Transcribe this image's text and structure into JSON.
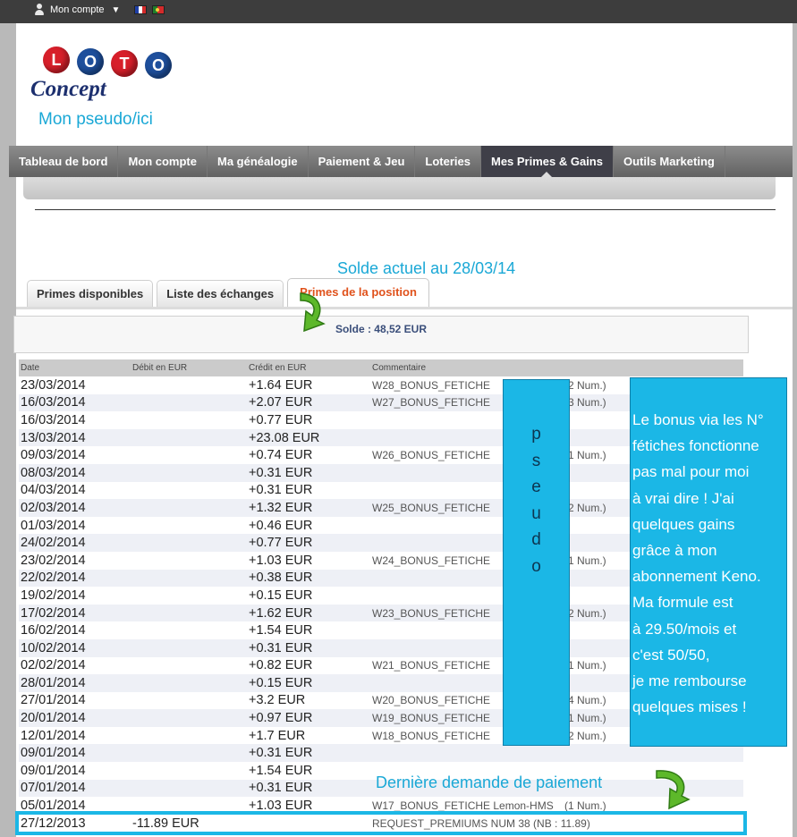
{
  "topbar": {
    "account_label": "Mon compte"
  },
  "header": {
    "logo_text": "LOTO Concept",
    "logo_letters": [
      "L",
      "O",
      "T",
      "O"
    ],
    "logo_word": "Concept",
    "pseudo": "Mon pseudo/ici"
  },
  "nav": {
    "items": [
      "Tableau de bord",
      "Mon compte",
      "Ma généalogie",
      "Paiement & Jeu",
      "Loteries",
      "Mes Primes & Gains",
      "Outils Marketing"
    ],
    "active_index": 5
  },
  "annotations": {
    "solde_caption": "Solde actuel au 28/03/14",
    "last_demand": "Dernière demande de paiement",
    "pseudo_letters": [
      "p",
      "s",
      "e",
      "u",
      "d",
      "o"
    ],
    "note_lines": [
      "Le bonus via les N°",
      "fétiches fonctionne",
      "pas mal pour moi",
      "à vrai dire !  J'ai",
      "quelques gains",
      "grâce à mon",
      "abonnement Keno.",
      "Ma formule est",
      "à 29.50/mois et",
      "c'est 50/50,",
      "je me rembourse",
      "quelques mises !"
    ]
  },
  "tabs": [
    "Primes disponibles",
    "Liste des échanges",
    "Primes de la position"
  ],
  "active_tab": 2,
  "solde": "Solde : 48,52 EUR",
  "table": {
    "headers": [
      "Date",
      "Débit en EUR",
      "Crédit en EUR",
      "Commentaire"
    ],
    "rows": [
      {
        "date": "23/03/2014",
        "debit": "",
        "credit": "+1.64 EUR",
        "comment": "W28_BONUS_FETICHE",
        "num": "(2 Num.)"
      },
      {
        "date": "16/03/2014",
        "debit": "",
        "credit": "+2.07 EUR",
        "comment": "W27_BONUS_FETICHE",
        "num": "(3 Num.)"
      },
      {
        "date": "16/03/2014",
        "debit": "",
        "credit": "+0.77 EUR",
        "comment": "",
        "num": ""
      },
      {
        "date": "13/03/2014",
        "debit": "",
        "credit": "+23.08 EUR",
        "comment": "",
        "num": ""
      },
      {
        "date": "09/03/2014",
        "debit": "",
        "credit": "+0.74 EUR",
        "comment": "W26_BONUS_FETICHE",
        "num": "(1 Num.)"
      },
      {
        "date": "08/03/2014",
        "debit": "",
        "credit": "+0.31 EUR",
        "comment": "",
        "num": ""
      },
      {
        "date": "04/03/2014",
        "debit": "",
        "credit": "+0.31 EUR",
        "comment": "",
        "num": ""
      },
      {
        "date": "02/03/2014",
        "debit": "",
        "credit": "+1.32 EUR",
        "comment": "W25_BONUS_FETICHE",
        "num": "(2 Num.)"
      },
      {
        "date": "01/03/2014",
        "debit": "",
        "credit": "+0.46 EUR",
        "comment": "",
        "num": ""
      },
      {
        "date": "24/02/2014",
        "debit": "",
        "credit": "+0.77 EUR",
        "comment": "",
        "num": ""
      },
      {
        "date": "23/02/2014",
        "debit": "",
        "credit": "+1.03 EUR",
        "comment": "W24_BONUS_FETICHE",
        "num": "(1 Num.)"
      },
      {
        "date": "22/02/2014",
        "debit": "",
        "credit": "+0.38 EUR",
        "comment": "",
        "num": ""
      },
      {
        "date": "19/02/2014",
        "debit": "",
        "credit": "+0.15 EUR",
        "comment": "",
        "num": ""
      },
      {
        "date": "17/02/2014",
        "debit": "",
        "credit": "+1.62 EUR",
        "comment": "W23_BONUS_FETICHE",
        "num": "(2 Num.)"
      },
      {
        "date": "16/02/2014",
        "debit": "",
        "credit": "+1.54 EUR",
        "comment": "",
        "num": ""
      },
      {
        "date": "10/02/2014",
        "debit": "",
        "credit": "+0.31 EUR",
        "comment": "",
        "num": ""
      },
      {
        "date": "02/02/2014",
        "debit": "",
        "credit": "+0.82 EUR",
        "comment": "W21_BONUS_FETICHE",
        "num": "(1 Num.)"
      },
      {
        "date": "28/01/2014",
        "debit": "",
        "credit": "+0.15 EUR",
        "comment": "",
        "num": ""
      },
      {
        "date": "27/01/2014",
        "debit": "",
        "credit": "+3.2 EUR",
        "comment": "W20_BONUS_FETICHE",
        "num": "(4 Num.)"
      },
      {
        "date": "20/01/2014",
        "debit": "",
        "credit": "+0.97 EUR",
        "comment": "W19_BONUS_FETICHE",
        "num": "(1 Num.)"
      },
      {
        "date": "12/01/2014",
        "debit": "",
        "credit": "+1.7 EUR",
        "comment": "W18_BONUS_FETICHE",
        "num": "(2 Num.)"
      },
      {
        "date": "09/01/2014",
        "debit": "",
        "credit": "+0.31 EUR",
        "comment": "",
        "num": ""
      },
      {
        "date": "09/01/2014",
        "debit": "",
        "credit": "+1.54 EUR",
        "comment": "",
        "num": ""
      },
      {
        "date": "07/01/2014",
        "debit": "",
        "credit": "+0.31 EUR",
        "comment": "",
        "num": ""
      },
      {
        "date": "05/01/2014",
        "debit": "",
        "credit": "+1.03 EUR",
        "comment": "W17_BONUS_FETICHE Lemon-HMS",
        "num": "(1 Num.)"
      },
      {
        "date": "27/12/2013",
        "debit": "-11.89 EUR",
        "credit": "",
        "comment": "REQUEST_PREMIUMS NUM 38 (NB : 11.89)",
        "num": "",
        "highlight": true
      }
    ]
  },
  "colors": {
    "accent": "#1bb7e6",
    "active_tab_text": "#e0521c",
    "nav_active": "#3f3f48",
    "arrow_green": "#5db82a"
  }
}
